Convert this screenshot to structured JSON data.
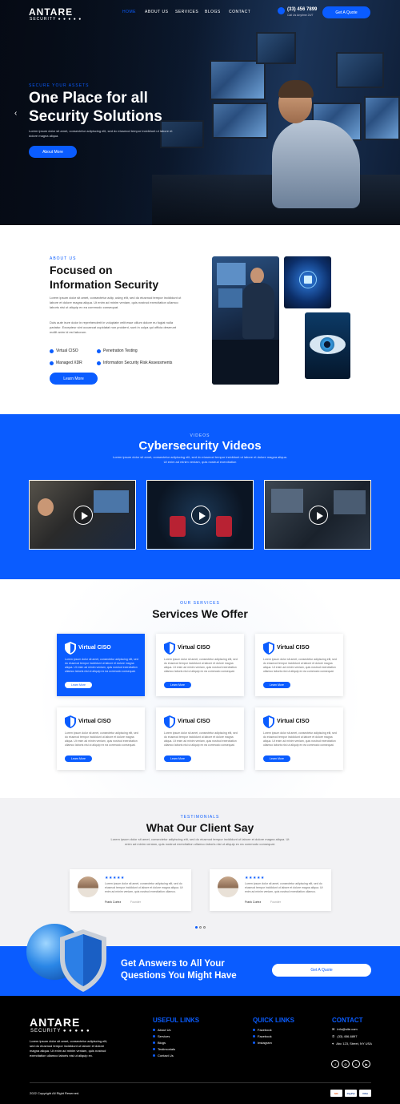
{
  "header": {
    "logo_main": "ANTARE",
    "logo_sub": "SECURITY ● ● ● ● ●",
    "nav": [
      "HOME",
      "ABOUT US",
      "SERVICES",
      "BLOGS",
      "CONTACT"
    ],
    "phone": "(33) 456 7899",
    "phone_caption": "Call Us Anytime 24/7",
    "quote_button": "Get A Quote",
    "active_color": "#0a5cff"
  },
  "hero": {
    "eyebrow": "SECURE YOUR ASSETS",
    "title_line1": "One Place for all",
    "title_line2": "Security Solutions",
    "text": "Lorem ipsum dolor sit amet, consectetur adipiscing elit, sed do eiusmod tempor incididunt ut labore et dolore magna aliqua.",
    "button": "About More",
    "prev_icon": "chevron-left-icon"
  },
  "about": {
    "eyebrow": "ABOUT US",
    "title_line1": "Focused on",
    "title_line2": "Information Security",
    "para1": "Lorem ipsum dolor sit amet, consectetur adip, using elit, sed do eiusmod tempor incididunt ut labore et dolore magna aliqua. Ut enim ad minim veniam, quis nostrud exercitation ullamco laboris nisi ut aliquip ex ea commodo consequat.",
    "para2": "Duis aute irure dolor in reprehenderit in voluptate velit esse cillum dolore eu fugiat nulla pariatur. Excepteur sint occaecat cupidatat non proident, sunt in culpa qui officia deserunt mollit anim id est laborum.",
    "features": [
      "Virtual CISO",
      "Penetration Testing",
      "Managed XDR",
      "Information Security Risk Assessments"
    ],
    "button": "Learn More"
  },
  "videos": {
    "eyebrow": "VIDEOS",
    "title": "Cybersecurity Videos",
    "text": "Lorem ipsum dolor sit amet, consectetur adipiscing elit, sed do eiusmod tempor incididunt ut labore et dolore magna aliqua. Ut enim ad minim veniam, quis nostrud exercitation"
  },
  "services": {
    "eyebrow": "OUR SERVICES",
    "title": "Services We Offer",
    "cards": [
      {
        "title": "Virtual CISO",
        "text": "Lorem ipsum dolor sit amet, consectetur adipiscing elit, sed do eiusmod tempor incididunt ut labore et dolore magna aliqua. Ut enim ad minim veniam, quis nostrud exercitation ullamco laboris nisi ut aliquip ex ea commodo consequat.",
        "button": "Learn More"
      },
      {
        "title": "Virtual CISO",
        "text": "Lorem ipsum dolor sit amet, consectetur adipiscing elit, sed do eiusmod tempor incididunt ut labore et dolore magna aliqua. Ut enim ad minim veniam, quis nostrud exercitation ullamco laboris nisi ut aliquip ex ea commodo consequat.",
        "button": "Learn More"
      },
      {
        "title": "Virtual CISO",
        "text": "Lorem ipsum dolor sit amet, consectetur adipiscing elit, sed do eiusmod tempor incididunt ut labore et dolore magna aliqua. Ut enim ad minim veniam, quis nostrud exercitation ullamco laboris nisi ut aliquip ex ea commodo consequat.",
        "button": "Learn More"
      },
      {
        "title": "Virtual CISO",
        "text": "Lorem ipsum dolor sit amet, consectetur adipiscing elit, sed do eiusmod tempor incididunt ut labore et dolore magna aliqua. Ut enim ad minim veniam, quis nostrud exercitation ullamco laboris nisi ut aliquip ex ea commodo consequat.",
        "button": "Learn More"
      },
      {
        "title": "Virtual CISO",
        "text": "Lorem ipsum dolor sit amet, consectetur adipiscing elit, sed do eiusmod tempor incididunt ut labore et dolore magna aliqua. Ut enim ad minim veniam, quis nostrud exercitation ullamco laboris nisi ut aliquip ex ea commodo consequat.",
        "button": "Learn More"
      },
      {
        "title": "Virtual CISO",
        "text": "Lorem ipsum dolor sit amet, consectetur adipiscing elit, sed do eiusmod tempor incididunt ut labore et dolore magna aliqua. Ut enim ad minim veniam, quis nostrud exercitation ullamco laboris nisi ut aliquip ex ea commodo consequat.",
        "button": "Learn More"
      }
    ]
  },
  "testimonials": {
    "eyebrow": "TESTIMONIALS",
    "title": "What Our Client Say",
    "text": "Lorem ipsum dolor sit amet, consectetur adipiscing elit, sed do eiusmod tempor incididunt ut labore et dolore magna aliqua. Ut enim ad minim veniam, quis nostrud exercitation ullamco laboris nisi ut aliquip ex ea commodo consequat.",
    "items": [
      {
        "stars": "★★★★★",
        "text": "Lorem ipsum dolor sit amet, consectetur adipiscing elit, sed do eiusmod tempor incididunt ut labore et dolore magna aliqua. Ut enim ad minim veniam, quis nostrud exercitation ullamco.",
        "name": "Frank Cortez",
        "role": "Founder"
      },
      {
        "stars": "★★★★★",
        "text": "Lorem ipsum dolor sit amet, consectetur adipiscing elit, sed do eiusmod tempor incididunt ut labore et dolore magna aliqua. Ut enim ad minim veniam, quis nostrud exercitation ullamco.",
        "name": "Frank Cortez",
        "role": "Founder"
      }
    ]
  },
  "cta": {
    "title_line1": "Get Answers to All Your",
    "title_line2": "Questions You Might Have",
    "button": "Get A Quote"
  },
  "footer": {
    "logo_main": "ANTARE",
    "logo_sub": "SECURITY ● ● ● ● ●",
    "about": "Lorem ipsum dolor sit amet, consectetur adipiscing elit, sed do eiusmod tempor incididunt ut labore et dolore magna aliqua. Ut enim ad minim veniam, quis nostrud exercitation ullamco laboris nisi ut aliquip ex.",
    "useful_title": "USEFUL LINKS",
    "useful_links": [
      "About Us",
      "Services",
      "Blogs",
      "Testimonials",
      "Contact Us"
    ],
    "quick_title": "QUICK LINKS",
    "quick_links": [
      "Facebook",
      "Facebook",
      "Instagram"
    ],
    "contact_title": "CONTACT",
    "contact": [
      "info@site.com",
      "(33) 456-6897",
      "Abc 123, Street, NY USA"
    ],
    "social": [
      "f",
      "◎",
      "t",
      "▶"
    ],
    "copyright": "2022 Copyright All Right Reserved.",
    "payments": [
      "MC",
      "PayPal",
      "VISA"
    ]
  }
}
